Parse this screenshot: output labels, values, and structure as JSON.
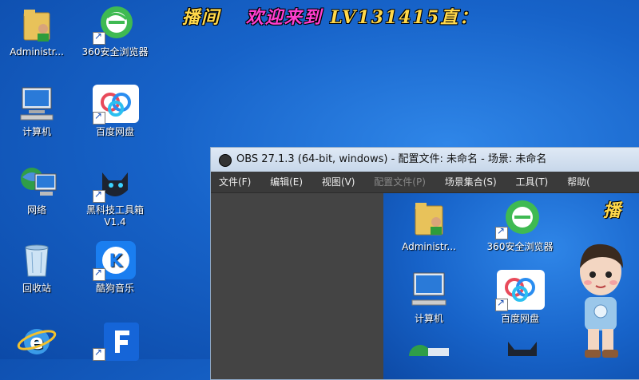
{
  "banner": {
    "part1": "播间",
    "part2": "欢迎来到",
    "part3": "LV131415直："
  },
  "desktop_icons": [
    {
      "label": "Administr..."
    },
    {
      "label": "360安全浏览器"
    },
    {
      "label": "计算机"
    },
    {
      "label": "百度网盘"
    },
    {
      "label": "网络"
    },
    {
      "label": "黑科技工具箱 V1.4"
    },
    {
      "label": "回收站"
    },
    {
      "label": "酷狗音乐"
    },
    {
      "label": ""
    },
    {
      "label": ""
    }
  ],
  "obs": {
    "title": "OBS 27.1.3 (64-bit, windows) - 配置文件: 未命名 - 场景: 未命名",
    "menu": [
      "文件(F)",
      "编辑(E)",
      "视图(V)",
      "配置文件(P)",
      "场景集合(S)",
      "工具(T)",
      "帮助("
    ],
    "preview_banner": "播",
    "preview_icons": [
      {
        "label": "Administr..."
      },
      {
        "label": "360安全浏览器"
      },
      {
        "label": "计算机"
      },
      {
        "label": "百度网盘"
      }
    ]
  },
  "colors": {
    "desktop_blue": "#1763c9",
    "banner_yellow": "#ffd84a",
    "banner_pink": "#ff3fd0"
  }
}
